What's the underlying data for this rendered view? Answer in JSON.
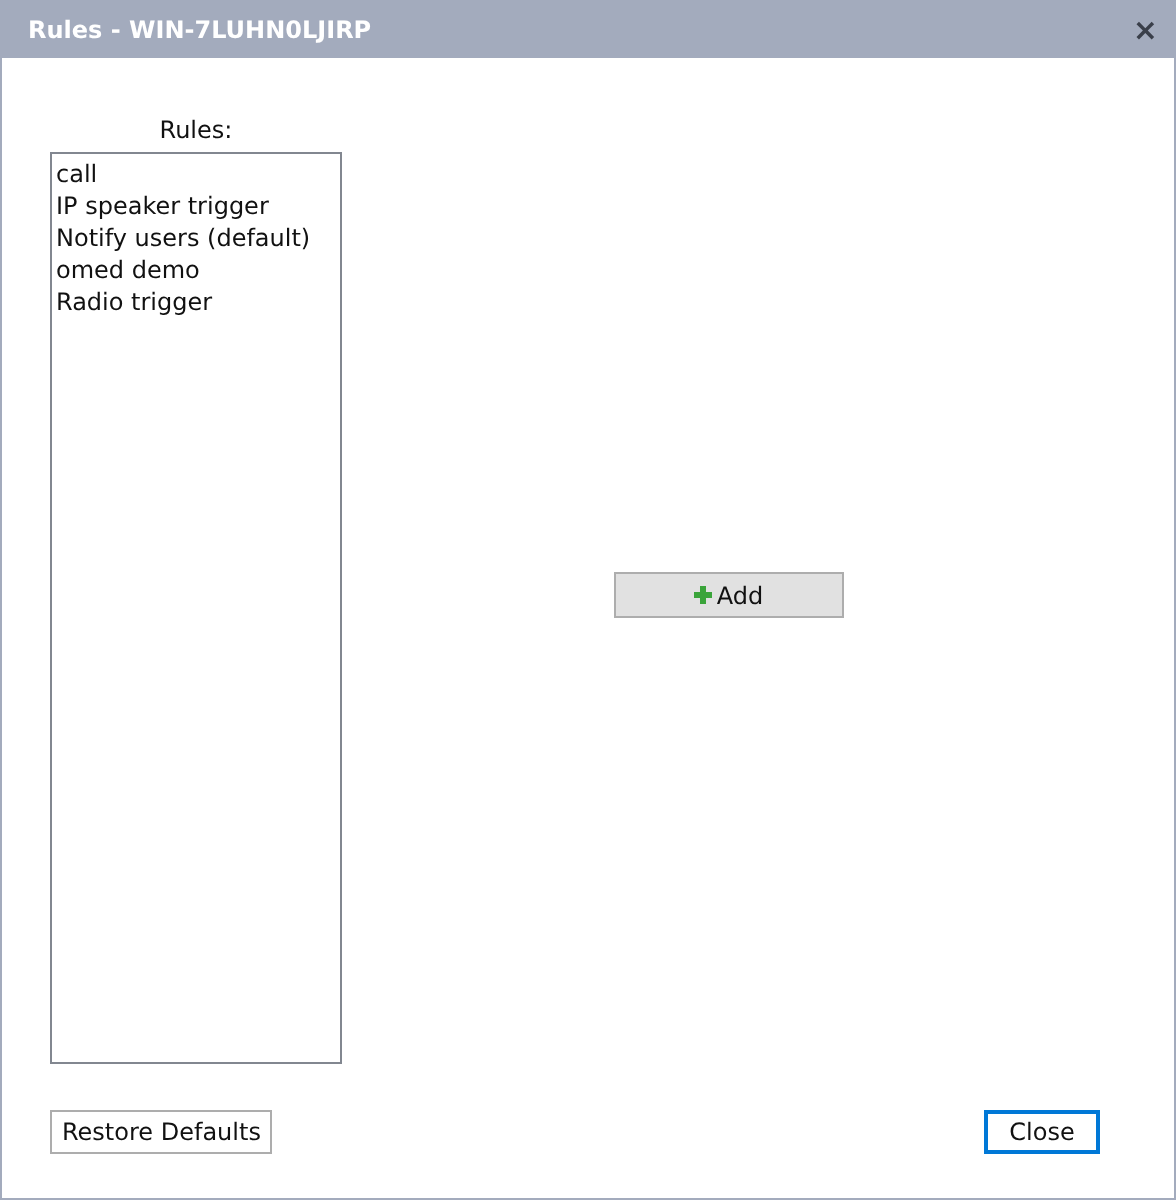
{
  "window": {
    "title": "Rules - WIN-7LUHN0LJIRP",
    "close_glyph": "×"
  },
  "rules_list": {
    "label": "Rules:",
    "items": [
      "call",
      "IP speaker trigger",
      "Notify users (default)",
      "omed demo",
      "Radio trigger"
    ]
  },
  "add_button": {
    "label": "Add"
  },
  "buttons": [
    {
      "label": "Restore Defaults",
      "kind": "secondary"
    },
    {
      "label": "Close",
      "kind": "default"
    }
  ]
}
